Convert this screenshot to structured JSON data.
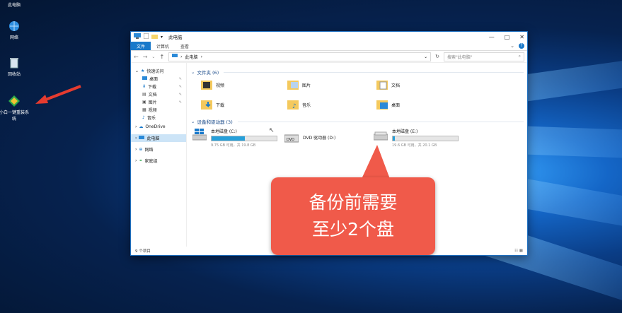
{
  "desktop": {
    "icons": [
      {
        "label": "此电脑",
        "icon": "computer-icon"
      },
      {
        "label": "网络",
        "icon": "network-icon"
      },
      {
        "label": "回收站",
        "icon": "recycle-bin-icon"
      },
      {
        "label": "小白一键重装系统",
        "icon": "installer-icon"
      }
    ]
  },
  "window": {
    "title": "此电脑",
    "ribbon_tabs": [
      "文件",
      "计算机",
      "查看"
    ],
    "address": {
      "path": "此电脑",
      "search_placeholder": "搜索\"此电脑\""
    },
    "nav_pane": {
      "quick_access": "快速访问",
      "quick_items": [
        "桌面",
        "下载",
        "文档",
        "图片",
        "视频",
        "音乐"
      ],
      "onedrive": "OneDrive",
      "this_pc": "此电脑",
      "network": "网络",
      "homegroup": "家庭组"
    },
    "folders_header": "文件夹 (6)",
    "folders": [
      {
        "name": "视频",
        "icon": "video-folder-icon"
      },
      {
        "name": "图片",
        "icon": "pictures-folder-icon"
      },
      {
        "name": "文档",
        "icon": "documents-folder-icon"
      },
      {
        "name": "下载",
        "icon": "downloads-folder-icon"
      },
      {
        "name": "音乐",
        "icon": "music-folder-icon"
      },
      {
        "name": "桌面",
        "icon": "desktop-folder-icon"
      }
    ],
    "drives_header": "设备和驱动器 (3)",
    "drives": [
      {
        "name": "本地磁盘 (C:)",
        "space": "9.75 GB 可用，共 19.8 GB",
        "used_fraction": 0.51,
        "icon": "windows-drive-icon"
      },
      {
        "name": "DVD 驱动器 (D:)",
        "space": "",
        "used_fraction": null,
        "icon": "dvd-drive-icon"
      },
      {
        "name": "本地磁盘 (E:)",
        "space": "19.6 GB 可用，共 20.1 GB",
        "used_fraction": 0.03,
        "icon": "hard-drive-icon"
      }
    ],
    "status": "9 个项目"
  },
  "callout": {
    "line1": "备份前需要",
    "line2": "至少2个盘"
  },
  "colors": {
    "accent": "#1979ca",
    "callout": "#f05a4a",
    "drive_fill": "#26a0da"
  }
}
